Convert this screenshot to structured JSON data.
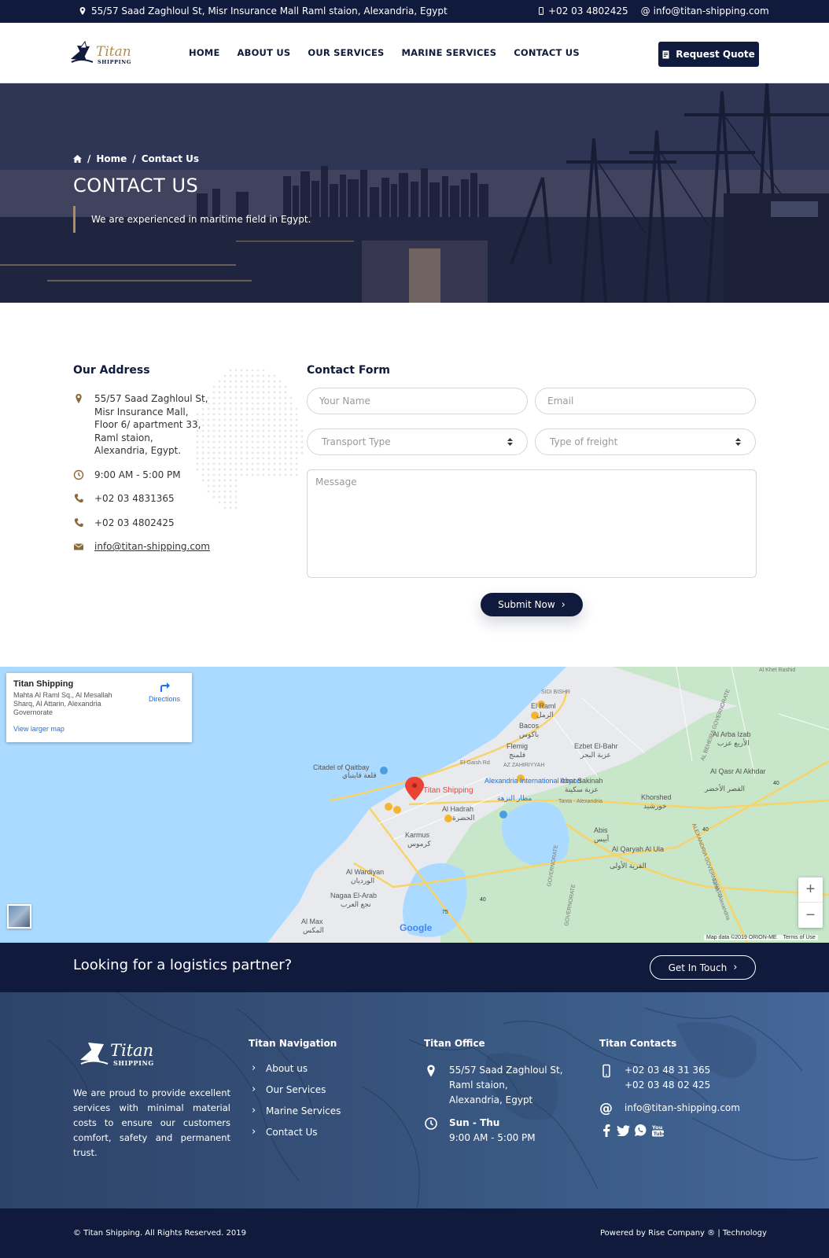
{
  "topbar": {
    "address": "55/57 Saad Zaghloul St, Misr Insurance Mall Raml staion, Alexandria, Egypt",
    "phone": "+02 03 4802425",
    "email": "info@titan-shipping.com"
  },
  "header": {
    "logo_text": "Titan",
    "logo_sub": "SHIPPING",
    "nav": [
      "HOME",
      "ABOUT US",
      "OUR SERVICES",
      "MARINE SERVICES",
      "CONTACT US"
    ],
    "quote_button": "Request Quote"
  },
  "hero": {
    "breadcrumb": [
      "Home",
      "Contact Us"
    ],
    "title": "CONTACT US",
    "tagline": "We are experienced in maritime field in Egypt."
  },
  "address": {
    "heading": "Our Address",
    "lines": [
      "55/57 Saad Zaghloul St,",
      "Misr Insurance Mall,",
      "Floor 6/ apartment 33,",
      "Raml staion,",
      "Alexandria, Egypt."
    ],
    "hours": "9:00 AM - 5:00 PM",
    "phone1": "+02 03 4831365",
    "phone2": "+02 03 4802425",
    "email": "info@titan-shipping.com"
  },
  "form": {
    "heading": "Contact Form",
    "name_placeholder": "Your Name",
    "email_placeholder": "Email",
    "transport_placeholder": "Transport Type",
    "freight_placeholder": "Type of freight",
    "message_placeholder": "Message",
    "submit": "Submit Now"
  },
  "map": {
    "place_name": "Titan Shipping",
    "place_address": "Mahta Al Raml Sq., Al Mesallah Sharq, Al Attarin, Alexandria Governorate",
    "directions": "Directions",
    "larger_map": "View larger map",
    "labels": {
      "sidi_bishr": "SIDI BISHR",
      "el_raml": "El Raml",
      "el_raml_ar": "الرمل",
      "bacos": "Bacos",
      "bacos_ar": "باكوس",
      "flemig": "Flemig",
      "flemig_ar": "فلمنج",
      "az_zahiriyyah": "AZ ZAHIRIYYAH",
      "ezbet": "Ezbet El-Bahr",
      "ezbet_ar": "عزبة البحر",
      "citadel": "Citadel of Qaitbay",
      "citadel_ar": "قلعة قايتباي",
      "titan": "Titan Shipping",
      "airport": "Alexandria International Airport",
      "airport_ar": "مطار النزهة",
      "izbat": "Izbat Sakinah",
      "izbat_ar": "عزبة سكينة",
      "khorshed": "Khorshed",
      "khorshed_ar": "خورشيد",
      "al_hadrah": "Al Hadrah",
      "al_hadrah_ar": "الحضرة",
      "karmus": "Karmus",
      "karmus_ar": "كرموس",
      "abis": "Abis",
      "abis_ar": "أبيس",
      "al_qaryah": "Al Qaryah Al Ula",
      "al_qaryah_ar": "القرية الأولى",
      "al_wardiyan": "Al Wardiyan",
      "al_wardiyan_ar": "الورديان",
      "nagaa": "Nagaa El-Arab",
      "nagaa_ar": "نجع العرب",
      "al_max": "Al Max",
      "al_max_ar": "المكس",
      "al_arba": "Al Arba Izab",
      "al_arba_ar": "الأربع عزب",
      "al_qasr": "Al Qasr Al Akhdar",
      "al_qasr_ar": "القصر الأخضر",
      "gov1": "ALEXANDRIA GOVERNORATE",
      "gov2": "AL BEHEIRA GOVERNORATE",
      "tanta_road": "Tanta - Alexandria",
      "tanta_road2": "Tanta - Alexandria",
      "el_gaish": "El-Gaish Rd",
      "khet": "Al Khet Rashid",
      "r40a": "40",
      "r40b": "40",
      "r40c": "40",
      "r75": "75",
      "governorate_a": "GOVERNORATE",
      "governorate_b": "GOVERNORATE"
    },
    "google": "Google",
    "map_data": "Map data ©2019 ORION-ME",
    "terms": "Terms of Use",
    "zoom_in": "+",
    "zoom_out": "−"
  },
  "cta": {
    "heading": "Looking for a logistics partner?",
    "button": "Get In Touch"
  },
  "footer": {
    "about": "We are proud to provide excellent services with minimal material costs to ensure our customers comfort, safety and permanent trust.",
    "nav_heading": "Titan Navigation",
    "nav": [
      "About us",
      "Our Services",
      "Marine Services",
      "Contact Us"
    ],
    "office_heading": "Titan Office",
    "office_lines": [
      "55/57 Saad Zaghloul St,",
      "Raml staion,",
      "Alexandria, Egypt"
    ],
    "office_days": "Sun - Thu",
    "office_hours": "9:00 AM - 5:00 PM",
    "contacts_heading": "Titan Contacts",
    "phone1": "+02 03 48 31 365",
    "phone2": "+02 03 48 02 425",
    "email": "info@titan-shipping.com"
  },
  "bottom": {
    "copyright": "© Titan Shipping. All Rights Reserved. 2019",
    "powered": "Powered by Rise Company ® | Technology"
  },
  "colors": {
    "navy": "#0f1a3c",
    "gold": "#b08d57",
    "footer_blue": "#3b5c87"
  }
}
